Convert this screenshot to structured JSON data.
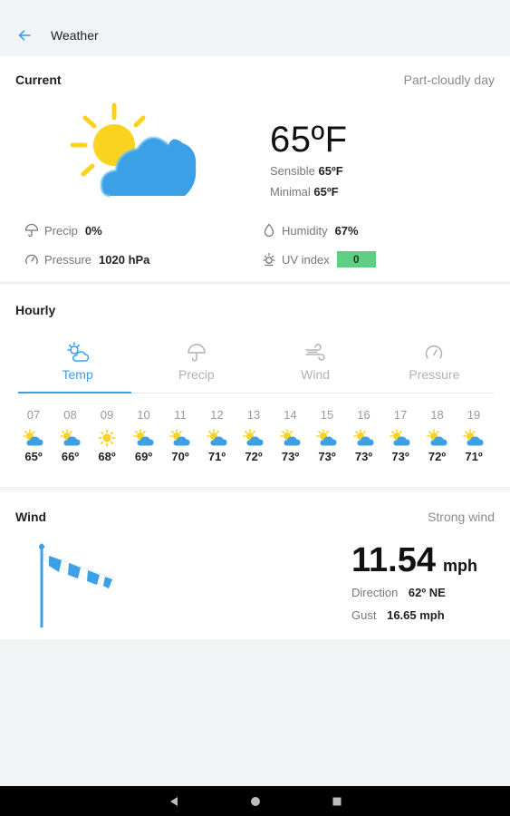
{
  "app_bar": {
    "title": "Weather",
    "back_icon": "arrow-left-icon"
  },
  "current": {
    "title": "Current",
    "condition": "Part-cloudly day",
    "temperature": "65ºF",
    "sensible_label": "Sensible",
    "sensible_value": "65ºF",
    "minimal_label": "Minimal",
    "minimal_value": "65ºF",
    "precip_label": "Precip",
    "precip_value": "0%",
    "humidity_label": "Humidity",
    "humidity_value": "67%",
    "pressure_label": "Pressure",
    "pressure_value": "1020 hPa",
    "uv_label": "UV index",
    "uv_value": "0",
    "colors": {
      "sun": "#f9d31f",
      "cloud": "#3ba0e6",
      "uv_badge": "#5fcf83"
    }
  },
  "hourly": {
    "title": "Hourly",
    "tabs": [
      {
        "label": "Temp",
        "icon": "sun-cloud-icon",
        "active": true
      },
      {
        "label": "Precip",
        "icon": "umbrella-icon",
        "active": false
      },
      {
        "label": "Wind",
        "icon": "wind-icon",
        "active": false
      },
      {
        "label": "Pressure",
        "icon": "gauge-icon",
        "active": false
      }
    ],
    "hours": [
      {
        "time": "07",
        "icon": "partly-cloudy-icon",
        "temp": "65º"
      },
      {
        "time": "08",
        "icon": "partly-cloudy-icon",
        "temp": "66º"
      },
      {
        "time": "09",
        "icon": "sun-icon",
        "temp": "68º"
      },
      {
        "time": "10",
        "icon": "partly-cloudy-icon",
        "temp": "69º"
      },
      {
        "time": "11",
        "icon": "partly-cloudy-icon",
        "temp": "70º"
      },
      {
        "time": "12",
        "icon": "partly-cloudy-icon",
        "temp": "71º"
      },
      {
        "time": "13",
        "icon": "partly-cloudy-icon",
        "temp": "72º"
      },
      {
        "time": "14",
        "icon": "partly-cloudy-icon",
        "temp": "73º"
      },
      {
        "time": "15",
        "icon": "partly-cloudy-icon",
        "temp": "73º"
      },
      {
        "time": "16",
        "icon": "partly-cloudy-icon",
        "temp": "73º"
      },
      {
        "time": "17",
        "icon": "partly-cloudy-icon",
        "temp": "73º"
      },
      {
        "time": "18",
        "icon": "partly-cloudy-icon",
        "temp": "72º"
      },
      {
        "time": "19",
        "icon": "partly-cloudy-icon",
        "temp": "71º"
      }
    ],
    "active_color": "#3ba0e6"
  },
  "wind": {
    "title": "Wind",
    "condition": "Strong wind",
    "speed": "11.54",
    "unit": "mph",
    "direction_label": "Direction",
    "direction_value": "62º NE",
    "gust_label": "Gust",
    "gust_value": "16.65 mph",
    "icon": "windsock-icon"
  },
  "nav": {
    "back": "nav-back-icon",
    "home": "nav-home-icon",
    "recents": "nav-recents-icon"
  }
}
